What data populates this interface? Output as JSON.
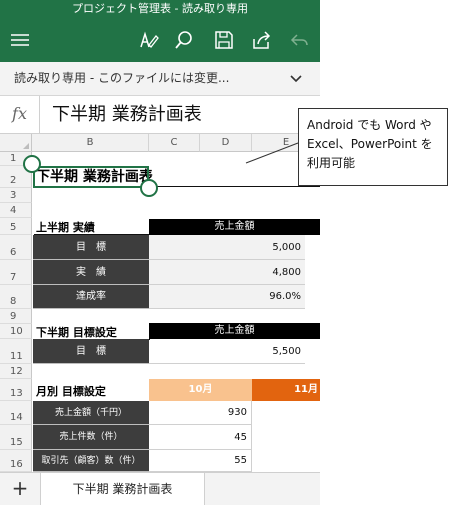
{
  "window": {
    "title": "プロジェクト管理表 - 読み取り専用"
  },
  "toolbar": {
    "icons": [
      "menu-icon",
      "draw-pen-icon",
      "search-icon",
      "save-icon",
      "share-icon",
      "undo-icon"
    ]
  },
  "readonly_banner": {
    "text": "読み取り専用 - このファイルには変更..."
  },
  "formula_bar": {
    "fx": "fx",
    "value": "下半期 業務計画表"
  },
  "columns": [
    "B",
    "C",
    "D",
    "E"
  ],
  "rows": [
    "1",
    "2",
    "3",
    "4",
    "5",
    "6",
    "7",
    "8",
    "9",
    "10",
    "11",
    "12",
    "13",
    "14",
    "15",
    "16"
  ],
  "sheet": {
    "title": "下半期 業務計画表",
    "first_half": {
      "heading": "上半期 実績",
      "header": "売上金額",
      "rows": [
        {
          "label": "目　標",
          "value": "5,000"
        },
        {
          "label": "実　績",
          "value": "4,800"
        },
        {
          "label": "達成率",
          "value": "96.0%"
        }
      ]
    },
    "second_half": {
      "heading": "下半期 目標設定",
      "header": "売上金額",
      "rows": [
        {
          "label": "目　標",
          "value": "5,500"
        }
      ]
    },
    "monthly": {
      "heading": "月別 目標設定",
      "months": [
        "10月",
        "11月"
      ],
      "rows": [
        {
          "label": "売上金額（千円）",
          "value": "930"
        },
        {
          "label": "売上件数（件）",
          "value": "45"
        },
        {
          "label": "取引先（顧客）数（件）",
          "value": "55"
        }
      ]
    }
  },
  "sheet_tabs": {
    "add": "+",
    "active": "下半期 業務計画表"
  },
  "callout": {
    "lines": [
      "Android でも Word や",
      "Excel、PowerPoint を",
      "利用可能"
    ]
  },
  "colors": {
    "brand": "#217346",
    "dark_cell": "#3d3d3d",
    "peach": "#f9c28e",
    "orange": "#e2640f",
    "selection": "#217346"
  }
}
